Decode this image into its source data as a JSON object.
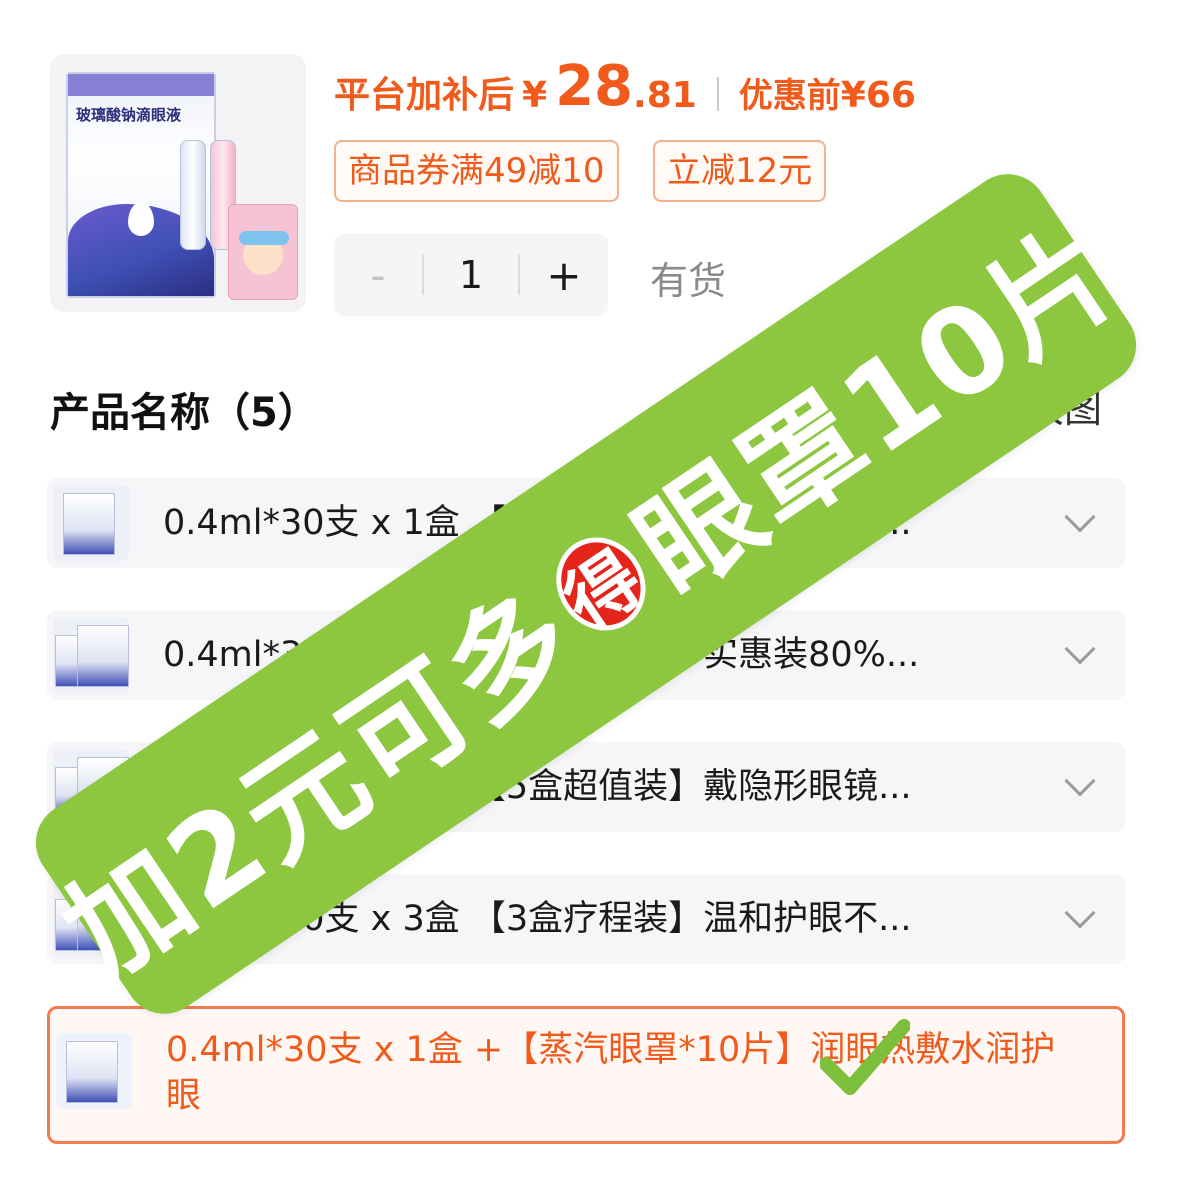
{
  "product": {
    "image_label": "玻璃酸钠滴眼液",
    "price_label": "平台加补后",
    "currency": "¥",
    "price_int": "28",
    "price_dec": ".81",
    "orig_label": "优惠前",
    "orig_price": "¥66",
    "coupons": [
      "商品券满49减10",
      "立减12元"
    ],
    "stock": "有货"
  },
  "stepper": {
    "minus": "-",
    "qty": "1",
    "plus": "+"
  },
  "section": {
    "title": "产品名称（5）",
    "view_label": "大图"
  },
  "options": [
    {
      "text": "0.4ml*30支 x 1盒 【1盒便携次抛型】不含防..."
    },
    {
      "text": "0.4ml*30支 x 2盒 【2盒囤货装！实惠装80%..."
    },
    {
      "text": "0.4ml*30支 x 5盒 【5盒超值装】戴隐形眼镜..."
    },
    {
      "text": "0.4ml*30支 x 3盒 【3盒疗程装】温和护眼不..."
    },
    {
      "text": "0.4ml*30支 x 1盒 +【蒸汽眼罩*10片】润眼热敷水润护眼"
    }
  ],
  "promo": {
    "before": "加2元可多",
    "badge": "得",
    "after": "眼罩10片"
  },
  "colors": {
    "accent": "#f05a1a",
    "promo_green": "#8dc63f",
    "badge_red": "#e5251b"
  }
}
